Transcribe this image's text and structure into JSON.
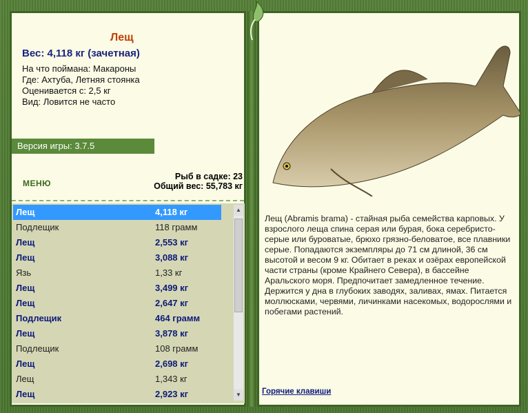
{
  "fish": {
    "name": "Лещ",
    "weight_line": "Вес: 4,118 кг (зачетная)",
    "bait": "На что поймана: Макароны",
    "place": "Где: Ахтуба, Летняя стоянка",
    "value": "Оценивается с: 2,5 кг",
    "type": "Вид: Ловится не часто"
  },
  "version": "Версия игры: 3.7.5",
  "menu_label": "МЕНЮ",
  "stats": {
    "count": "Рыб в садке: 23",
    "total": "Общий вес: 55,783 кг"
  },
  "catch_list": [
    {
      "name": "Лещ",
      "weight": "4,118 кг",
      "style": "selected"
    },
    {
      "name": "Подлещик",
      "weight": "118 грамм",
      "style": "plain"
    },
    {
      "name": "Лещ",
      "weight": "2,553 кг",
      "style": "bold"
    },
    {
      "name": "Лещ",
      "weight": "3,088 кг",
      "style": "bold"
    },
    {
      "name": "Язь",
      "weight": "1,33 кг",
      "style": "plain"
    },
    {
      "name": "Лещ",
      "weight": "3,499 кг",
      "style": "bold"
    },
    {
      "name": "Лещ",
      "weight": "2,647 кг",
      "style": "bold"
    },
    {
      "name": "Подлещик",
      "weight": "464 грамм",
      "style": "bold"
    },
    {
      "name": "Лещ",
      "weight": "3,878 кг",
      "style": "bold"
    },
    {
      "name": "Подлещик",
      "weight": "108 грамм",
      "style": "plain"
    },
    {
      "name": "Лещ",
      "weight": "2,698 кг",
      "style": "bold"
    },
    {
      "name": "Лещ",
      "weight": "1,343 кг",
      "style": "plain"
    },
    {
      "name": "Лещ",
      "weight": "2,923 кг",
      "style": "bold"
    }
  ],
  "description": "Лещ (Abramis brama) - стайная рыба семейства карповых. У взрослого леща спина серая или бурая, бока серебристо-серые или буроватые, брюхо грязно-беловатое, все плавники серые. Попадаются экземпляры до 71 см длиной, 36 см высотой и весом 9 кг. Обитает в реках и озёрах европейской части страны (кроме Крайнего Севера), в бассейне Аральского моря. Предпочитает замедленное течение. Держится у дна в глубоких заводях, заливах, ямах. Питается моллюсками, червями, личинками насекомых, водорослями и побегами растений.",
  "hotkeys_label": "Горячие клавиши",
  "icons": {
    "scroll_up": "scroll-up-arrow-icon",
    "scroll_down": "scroll-down-arrow-icon",
    "leaf": "leaf-ornament-icon",
    "fish": "bream-fish-image"
  },
  "colors": {
    "frame": "#4e7c32",
    "panel_bg": "#fbfbe6",
    "title": "#c04000",
    "weight": "#1a237e",
    "selected": "#3399ff"
  }
}
